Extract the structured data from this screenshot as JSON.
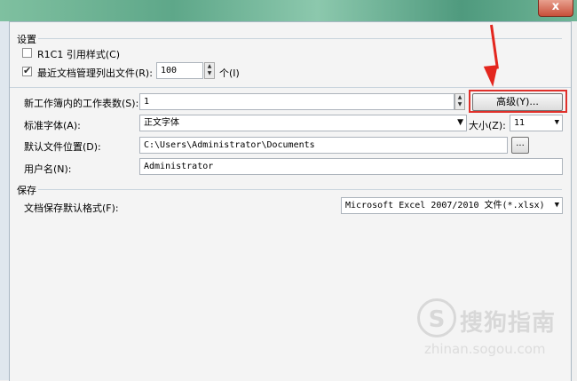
{
  "window": {
    "close_label": "x"
  },
  "settings": {
    "title": "设置",
    "r1c1_label": "R1C1 引用样式(C)",
    "r1c1_checked": false,
    "recent_label": "最近文档管理列出文件(R):",
    "recent_checked": true,
    "recent_count": "100",
    "recent_unit": "个(I)"
  },
  "workbook": {
    "sheets_label": "新工作簿内的工作表数(S):",
    "sheets_value": "1",
    "advanced_button": "高级(Y)...",
    "font_label": "标准字体(A):",
    "font_value": "正文字体",
    "size_label": "大小(Z):",
    "size_value": "11",
    "location_label": "默认文件位置(D):",
    "location_value": "C:\\Users\\Administrator\\Documents",
    "browse_label": "...",
    "username_label": "用户名(N):",
    "username_value": "Administrator"
  },
  "save": {
    "title": "保存",
    "format_label": "文档保存默认格式(F):",
    "format_value": "Microsoft Excel 2007/2010 文件(*.xlsx)"
  },
  "watermark": {
    "logo": "S",
    "text": "搜狗指南",
    "url": "zhinan.sogou.com"
  },
  "colors": {
    "highlight": "#e0302a",
    "arrow": "#e3261e"
  }
}
